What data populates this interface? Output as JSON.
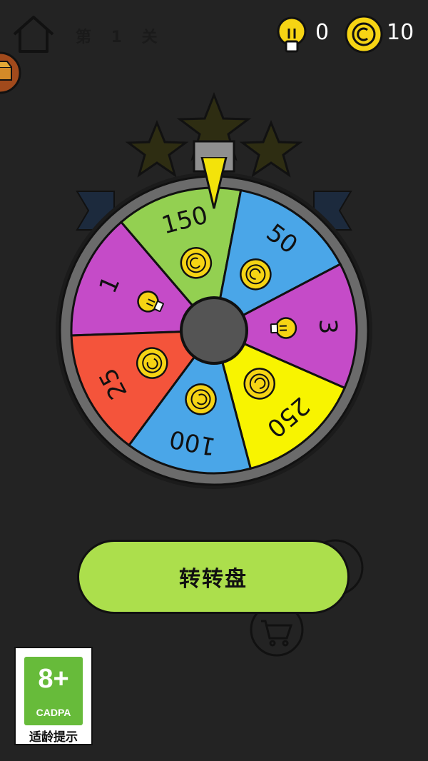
{
  "header": {
    "level_text": "第 1 关",
    "hint_count": "0",
    "coin_count": "10"
  },
  "wheel": {
    "segments": [
      {
        "label": "1",
        "reward": "hint",
        "color": "#c54bc8"
      },
      {
        "label": "150",
        "reward": "coin",
        "color": "#93d051"
      },
      {
        "label": "50",
        "reward": "coin",
        "color": "#4aa6e8"
      },
      {
        "label": "3",
        "reward": "hint",
        "color": "#c54bc8"
      },
      {
        "label": "250",
        "reward": "coin",
        "color": "#f8f400"
      },
      {
        "label": "100",
        "reward": "coin",
        "color": "#4aa6e8"
      },
      {
        "label": "25",
        "reward": "coin",
        "color": "#f4543b"
      }
    ]
  },
  "spin_button": {
    "label": "转转盘"
  },
  "rating": {
    "age": "8+",
    "org": "CADPA",
    "caption": "适龄提示"
  },
  "colors": {
    "background": "#232323",
    "coin": "#f6d414",
    "button": "#acdf4c",
    "pointer": "#f3e30a",
    "wheel_rim": "#6b6b6b"
  },
  "icons": [
    "home-icon",
    "hint-bulb-icon",
    "coin-icon",
    "chest-icon",
    "star-icon",
    "cart-icon"
  ]
}
